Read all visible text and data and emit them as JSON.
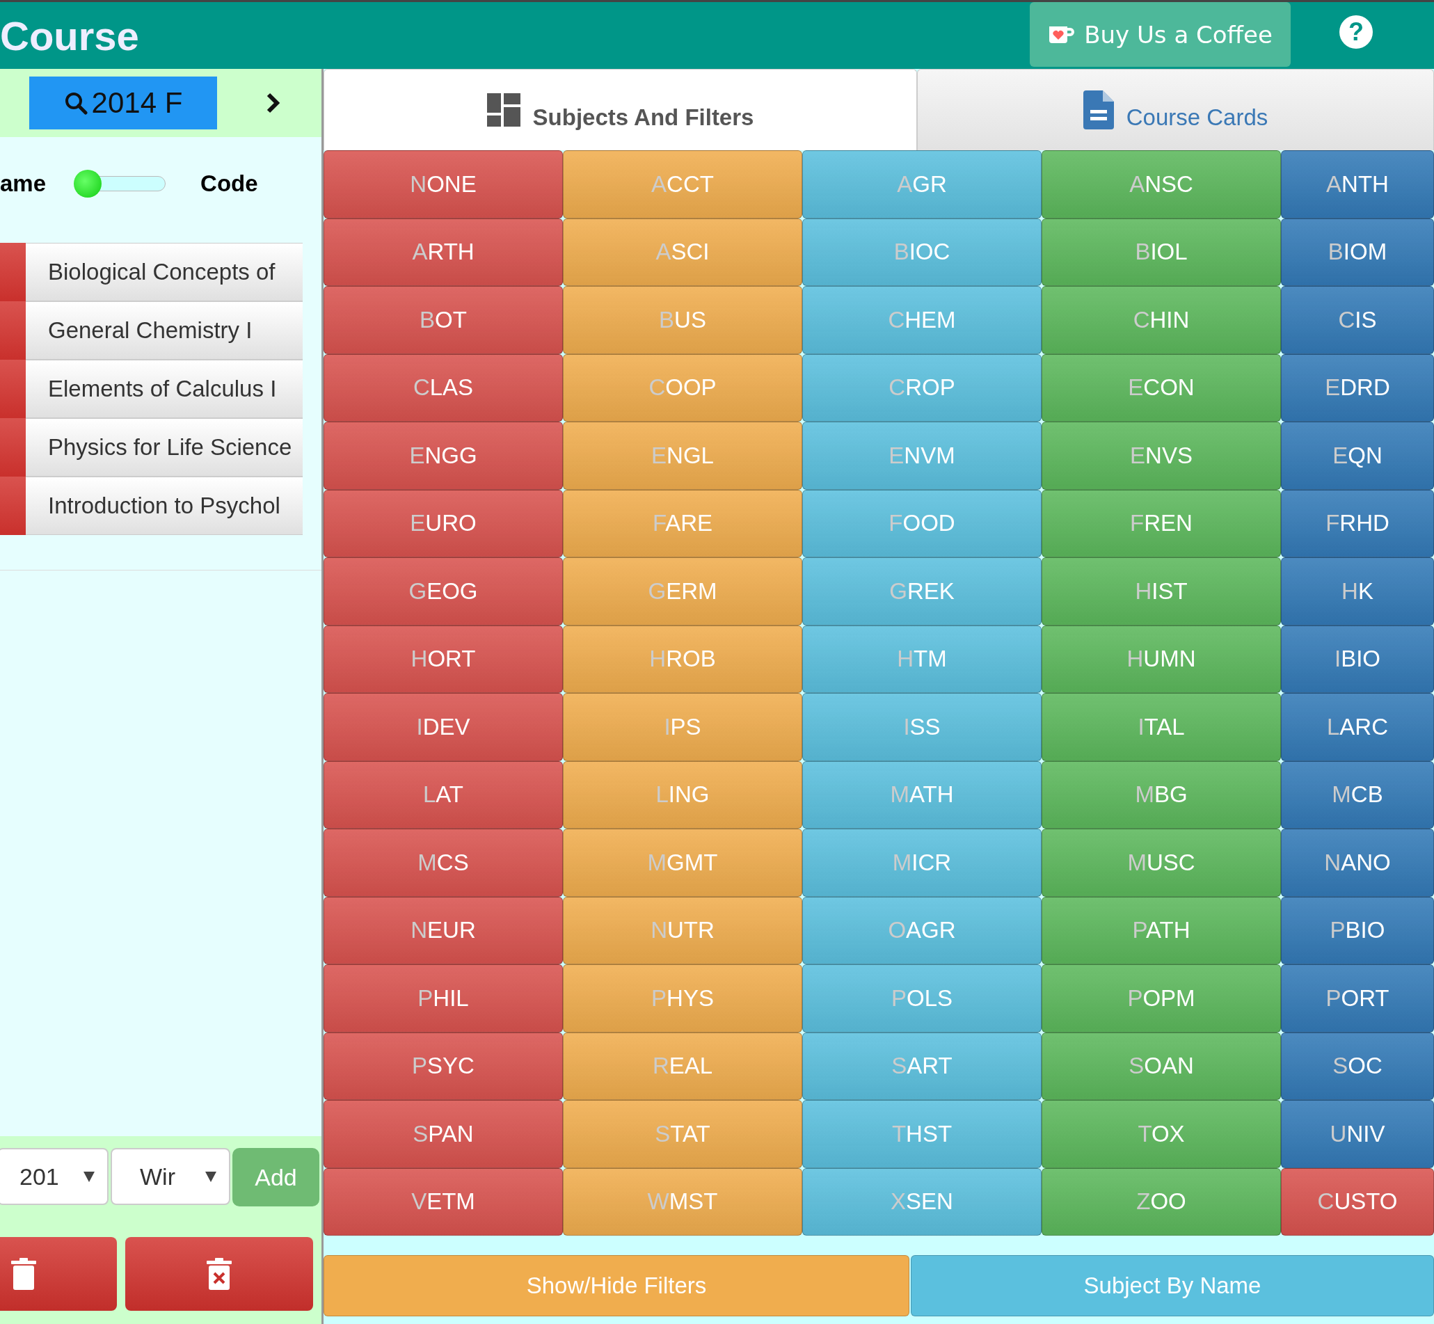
{
  "header": {
    "title": "Course",
    "coffee_button": "Buy Us a Coffee",
    "help_button": "?"
  },
  "sidebar": {
    "term_button": "2014 F",
    "toggle": {
      "left_label": "ame",
      "right_label": "Code",
      "on": false
    },
    "courses": [
      {
        "name": "Biological Concepts of"
      },
      {
        "name": "General Chemistry I"
      },
      {
        "name": "Elements of Calculus I"
      },
      {
        "name": "Physics for Life Science"
      },
      {
        "name": "Introduction to Psychol"
      }
    ],
    "year_select": "201",
    "term_select": "Wir",
    "add_button": "Add"
  },
  "tabs": [
    {
      "label": "Subjects And Filters",
      "selected": true
    },
    {
      "label": "Course Cards",
      "selected": false
    }
  ],
  "subjects": [
    {
      "code": "NONE",
      "color": "#d9534f"
    },
    {
      "code": "ACCT",
      "color": "#f0ad4e"
    },
    {
      "code": "AGR",
      "color": "#5bc0de"
    },
    {
      "code": "ANSC",
      "color": "#5cb85c"
    },
    {
      "code": "ANTH",
      "color": "#337ab7"
    },
    {
      "code": "ARTH",
      "color": "#d9534f"
    },
    {
      "code": "ASCI",
      "color": "#f0ad4e"
    },
    {
      "code": "BIOC",
      "color": "#5bc0de"
    },
    {
      "code": "BIOL",
      "color": "#5cb85c"
    },
    {
      "code": "BIOM",
      "color": "#337ab7"
    },
    {
      "code": "BOT",
      "color": "#d9534f"
    },
    {
      "code": "BUS",
      "color": "#f0ad4e"
    },
    {
      "code": "CHEM",
      "color": "#5bc0de"
    },
    {
      "code": "CHIN",
      "color": "#5cb85c"
    },
    {
      "code": "CIS",
      "color": "#337ab7"
    },
    {
      "code": "CLAS",
      "color": "#d9534f"
    },
    {
      "code": "COOP",
      "color": "#f0ad4e"
    },
    {
      "code": "CROP",
      "color": "#5bc0de"
    },
    {
      "code": "ECON",
      "color": "#5cb85c"
    },
    {
      "code": "EDRD",
      "color": "#337ab7"
    },
    {
      "code": "ENGG",
      "color": "#d9534f"
    },
    {
      "code": "ENGL",
      "color": "#f0ad4e"
    },
    {
      "code": "ENVM",
      "color": "#5bc0de"
    },
    {
      "code": "ENVS",
      "color": "#5cb85c"
    },
    {
      "code": "EQN",
      "color": "#337ab7"
    },
    {
      "code": "EURO",
      "color": "#d9534f"
    },
    {
      "code": "FARE",
      "color": "#f0ad4e"
    },
    {
      "code": "FOOD",
      "color": "#5bc0de"
    },
    {
      "code": "FREN",
      "color": "#5cb85c"
    },
    {
      "code": "FRHD",
      "color": "#337ab7"
    },
    {
      "code": "GEOG",
      "color": "#d9534f"
    },
    {
      "code": "GERM",
      "color": "#f0ad4e"
    },
    {
      "code": "GREK",
      "color": "#5bc0de"
    },
    {
      "code": "HIST",
      "color": "#5cb85c"
    },
    {
      "code": "HK",
      "color": "#337ab7"
    },
    {
      "code": "HORT",
      "color": "#d9534f"
    },
    {
      "code": "HROB",
      "color": "#f0ad4e"
    },
    {
      "code": "HTM",
      "color": "#5bc0de"
    },
    {
      "code": "HUMN",
      "color": "#5cb85c"
    },
    {
      "code": "IBIO",
      "color": "#337ab7"
    },
    {
      "code": "IDEV",
      "color": "#d9534f"
    },
    {
      "code": "IPS",
      "color": "#f0ad4e"
    },
    {
      "code": "ISS",
      "color": "#5bc0de"
    },
    {
      "code": "ITAL",
      "color": "#5cb85c"
    },
    {
      "code": "LARC",
      "color": "#337ab7"
    },
    {
      "code": "LAT",
      "color": "#d9534f"
    },
    {
      "code": "LING",
      "color": "#f0ad4e"
    },
    {
      "code": "MATH",
      "color": "#5bc0de"
    },
    {
      "code": "MBG",
      "color": "#5cb85c"
    },
    {
      "code": "MCB",
      "color": "#337ab7"
    },
    {
      "code": "MCS",
      "color": "#d9534f"
    },
    {
      "code": "MGMT",
      "color": "#f0ad4e"
    },
    {
      "code": "MICR",
      "color": "#5bc0de"
    },
    {
      "code": "MUSC",
      "color": "#5cb85c"
    },
    {
      "code": "NANO",
      "color": "#337ab7"
    },
    {
      "code": "NEUR",
      "color": "#d9534f"
    },
    {
      "code": "NUTR",
      "color": "#f0ad4e"
    },
    {
      "code": "OAGR",
      "color": "#5bc0de"
    },
    {
      "code": "PATH",
      "color": "#5cb85c"
    },
    {
      "code": "PBIO",
      "color": "#337ab7"
    },
    {
      "code": "PHIL",
      "color": "#d9534f"
    },
    {
      "code": "PHYS",
      "color": "#f0ad4e"
    },
    {
      "code": "POLS",
      "color": "#5bc0de"
    },
    {
      "code": "POPM",
      "color": "#5cb85c"
    },
    {
      "code": "PORT",
      "color": "#337ab7"
    },
    {
      "code": "PSYC",
      "color": "#d9534f"
    },
    {
      "code": "REAL",
      "color": "#f0ad4e"
    },
    {
      "code": "SART",
      "color": "#5bc0de"
    },
    {
      "code": "SOAN",
      "color": "#5cb85c"
    },
    {
      "code": "SOC",
      "color": "#337ab7"
    },
    {
      "code": "SPAN",
      "color": "#d9534f"
    },
    {
      "code": "STAT",
      "color": "#f0ad4e"
    },
    {
      "code": "THST",
      "color": "#5bc0de"
    },
    {
      "code": "TOX",
      "color": "#5cb85c"
    },
    {
      "code": "UNIV",
      "color": "#337ab7"
    },
    {
      "code": "VETM",
      "color": "#d9534f"
    },
    {
      "code": "WMST",
      "color": "#f0ad4e"
    },
    {
      "code": "XSEN",
      "color": "#5bc0de"
    },
    {
      "code": "ZOO",
      "color": "#5cb85c"
    },
    {
      "code": "CUSTO",
      "color": "#d9534f"
    }
  ],
  "bottom_buttons": [
    {
      "label": "Show/Hide Filters",
      "color": "#f0ad4e"
    },
    {
      "label": "Subject By Name",
      "color": "#5bc0de"
    }
  ]
}
